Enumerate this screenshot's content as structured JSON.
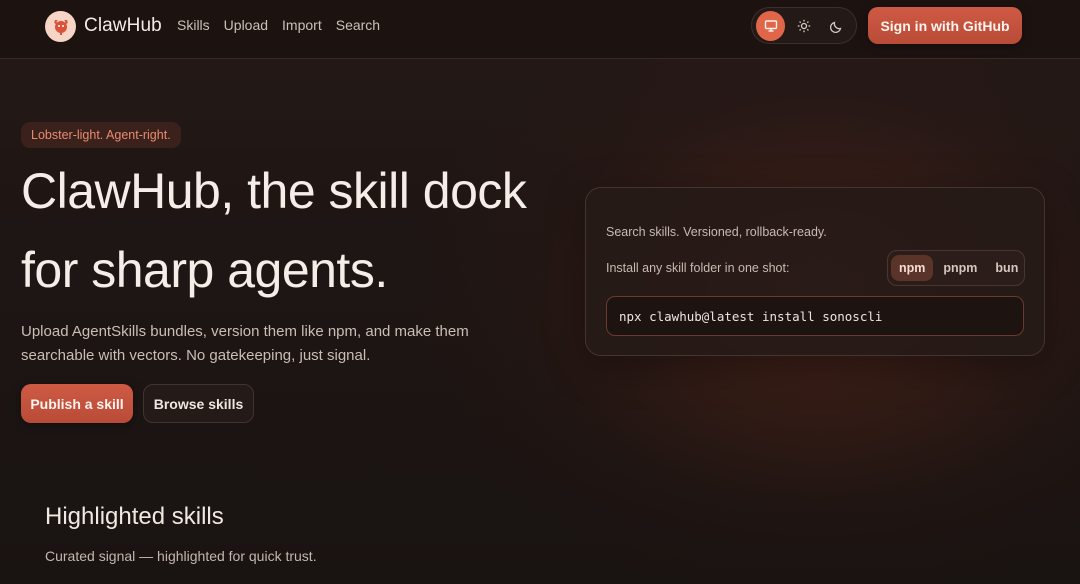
{
  "header": {
    "brand": "ClawHub",
    "nav": [
      "Skills",
      "Upload",
      "Import",
      "Search"
    ],
    "theme_options": [
      {
        "name": "system",
        "icon": "monitor-icon",
        "active": true
      },
      {
        "name": "light",
        "icon": "sun-icon",
        "active": false
      },
      {
        "name": "dark",
        "icon": "moon-icon",
        "active": false
      }
    ],
    "signin_label": "Sign in  with GitHub"
  },
  "hero": {
    "tagline": "Lobster-light. Agent-right.",
    "title_line1": "ClawHub, the skill dock",
    "title_line2": "for sharp agents.",
    "description": "Upload AgentSkills bundles, version them like npm, and make them searchable with vectors. No gatekeeping, just signal.",
    "primary_cta": "Publish a skill",
    "secondary_cta": "Browse skills"
  },
  "install_card": {
    "line1": "Search skills. Versioned, rollback-ready.",
    "line2": "Install any skill folder in one shot:",
    "package_managers": [
      "npm",
      "pnpm",
      "bun"
    ],
    "selected_pm": "npm",
    "command": "npx clawhub@latest install sonoscli"
  },
  "highlighted": {
    "title": "Highlighted skills",
    "subtitle": "Curated signal — highlighted for quick trust."
  },
  "colors": {
    "accent": "#cf5a44",
    "background": "#1e1614",
    "tagline_text": "#e98a72"
  }
}
